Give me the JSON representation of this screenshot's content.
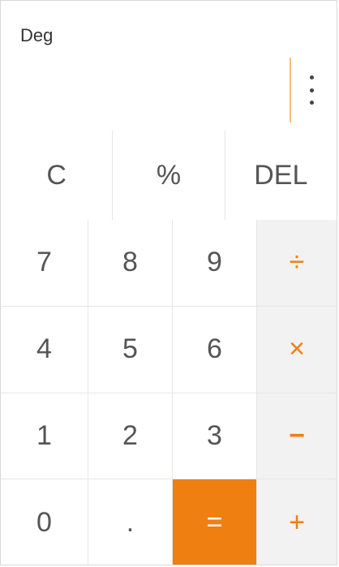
{
  "display": {
    "mode": "Deg",
    "menu_icon": "more-vert-icon",
    "accent_color": "#f07f12"
  },
  "top_row": [
    "C",
    "%",
    "DEL"
  ],
  "keys": {
    "row1": [
      "7",
      "8",
      "9",
      "÷"
    ],
    "row2": [
      "4",
      "5",
      "6",
      "×"
    ],
    "row3": [
      "1",
      "2",
      "3",
      "−"
    ],
    "row4": [
      "0",
      ".",
      "=",
      "+"
    ]
  }
}
